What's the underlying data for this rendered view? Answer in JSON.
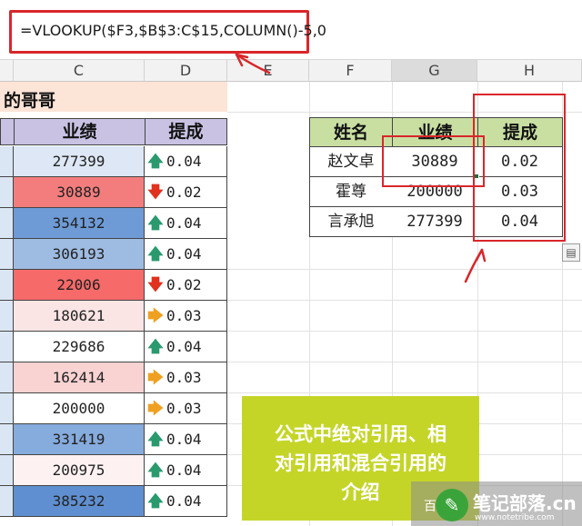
{
  "formula_bar": {
    "formula": "=VLOOKUP($F3,$B$3:C$15,COLUMN()-5,0"
  },
  "column_headers": [
    "C",
    "D",
    "E",
    "F",
    "G",
    "H"
  ],
  "title_cell": "的哥哥",
  "left_table": {
    "headers": [
      "业绩",
      "提成"
    ],
    "rows": [
      {
        "value": "277399",
        "icon": "up-arrow-icon",
        "glyph": "🡅",
        "rate": "0.04",
        "fill": "#dde7f5"
      },
      {
        "value": "30889",
        "icon": "down-arrow-icon",
        "glyph": "🡇",
        "rate": "0.02",
        "fill": "#f37d7d"
      },
      {
        "value": "354132",
        "icon": "up-arrow-icon",
        "glyph": "🡅",
        "rate": "0.04",
        "fill": "#6e9bd6"
      },
      {
        "value": "306193",
        "icon": "up-arrow-icon",
        "glyph": "🡅",
        "rate": "0.04",
        "fill": "#9ebbe2"
      },
      {
        "value": "22006",
        "icon": "down-arrow-icon",
        "glyph": "🡇",
        "rate": "0.02",
        "fill": "#f66a6a"
      },
      {
        "value": "180621",
        "icon": "right-arrow-icon",
        "glyph": "🡆",
        "rate": "0.03",
        "fill": "#fbe4e4"
      },
      {
        "value": "229686",
        "icon": "up-arrow-icon",
        "glyph": "🡅",
        "rate": "0.04",
        "fill": "#ffffff"
      },
      {
        "value": "162414",
        "icon": "right-arrow-icon",
        "glyph": "🡆",
        "rate": "0.03",
        "fill": "#f9d2d2"
      },
      {
        "value": "200000",
        "icon": "right-arrow-icon",
        "glyph": "🡆",
        "rate": "0.03",
        "fill": "#ffffff"
      },
      {
        "value": "331419",
        "icon": "up-arrow-icon",
        "glyph": "🡅",
        "rate": "0.04",
        "fill": "#86abdd"
      },
      {
        "value": "200975",
        "icon": "up-arrow-icon",
        "glyph": "🡅",
        "rate": "0.04",
        "fill": "#fdf1f1"
      },
      {
        "value": "385232",
        "icon": "up-arrow-icon",
        "glyph": "🡅",
        "rate": "0.04",
        "fill": "#5f8fd0"
      }
    ]
  },
  "right_table": {
    "headers": [
      "姓名",
      "业绩",
      "提成"
    ],
    "rows": [
      {
        "name": "赵文卓",
        "value": "30889",
        "rate": "0.02"
      },
      {
        "name": "霍尊",
        "value": "200000",
        "rate": "0.03"
      },
      {
        "name": "言承旭",
        "value": "277399",
        "rate": "0.04"
      }
    ]
  },
  "caption": {
    "line1": "公式中绝对引用、相",
    "line2": "对引用和混合引用的",
    "line3": "介绍"
  },
  "watermark": {
    "left_text": "百",
    "title": "笔记部落.cn",
    "subtitle": "www.notetribe.com"
  },
  "colors": {
    "annotation_red": "#d9262a",
    "left_header_fill": "#c9c2e3",
    "right_header_fill": "#c9dfa2",
    "title_fill": "#fce4d6",
    "caption_fill": "#c4d528"
  }
}
